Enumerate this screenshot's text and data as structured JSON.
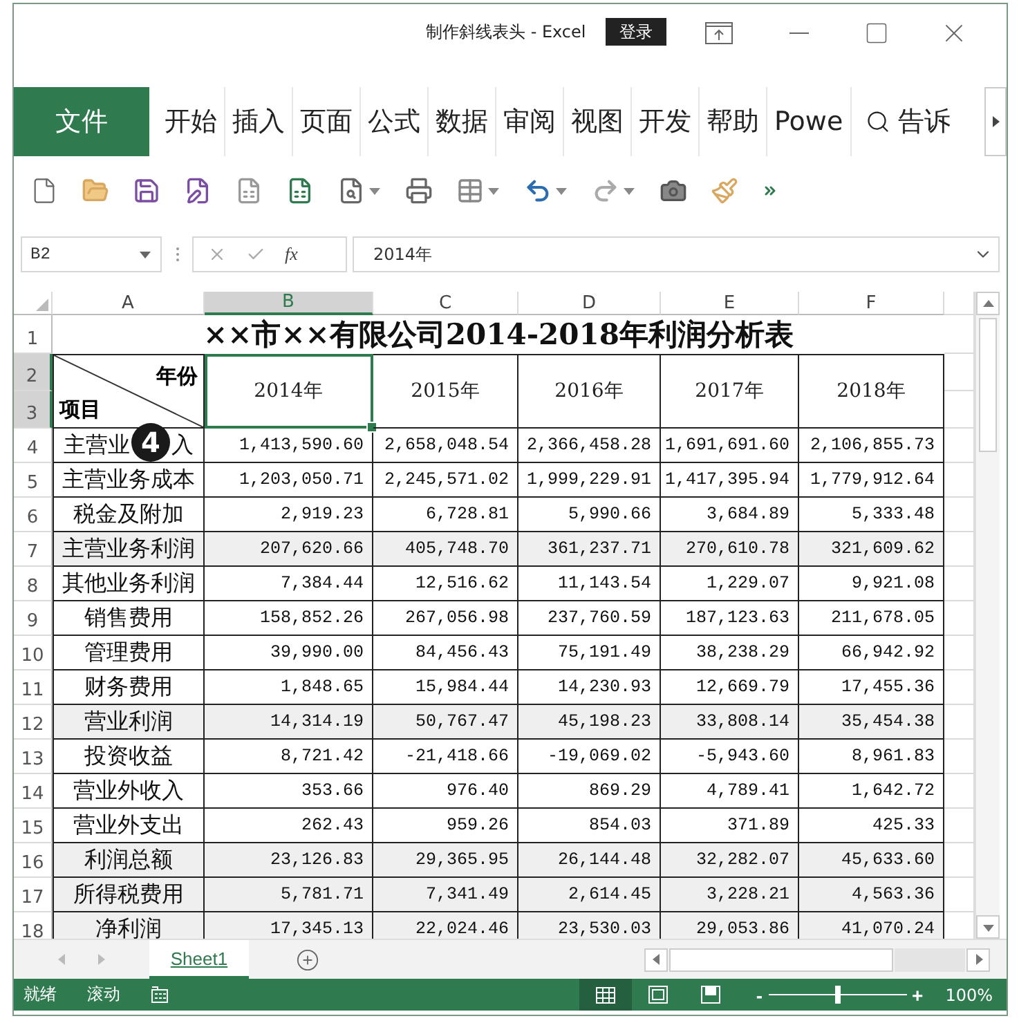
{
  "window": {
    "title": "制作斜线表头 - Excel",
    "login": "登录"
  },
  "ribbon": {
    "tabs": [
      {
        "label": "文件",
        "kind": "file",
        "selected": false
      },
      {
        "label": "开始",
        "kind": "tab",
        "selected": false
      },
      {
        "label": "插入",
        "kind": "tab",
        "selected": false
      },
      {
        "label": "页面",
        "kind": "tab",
        "selected": false
      },
      {
        "label": "公式",
        "kind": "tab",
        "selected": false
      },
      {
        "label": "数据",
        "kind": "tab",
        "selected": false
      },
      {
        "label": "审阅",
        "kind": "tab",
        "selected": false
      },
      {
        "label": "视图",
        "kind": "tab",
        "selected": false
      },
      {
        "label": "开发",
        "kind": "tab",
        "selected": false
      },
      {
        "label": "帮助",
        "kind": "tab",
        "selected": false
      },
      {
        "label": "Powe",
        "kind": "tab",
        "selected": false
      }
    ],
    "tell_me": "告诉"
  },
  "formula_bar": {
    "name_box": "B2",
    "function_label": "fx",
    "value": "2014年"
  },
  "column_headers": [
    {
      "label": "A",
      "selected": false
    },
    {
      "label": "B",
      "selected": true
    },
    {
      "label": "C",
      "selected": false
    },
    {
      "label": "D",
      "selected": false
    },
    {
      "label": "E",
      "selected": false
    },
    {
      "label": "F",
      "selected": false
    }
  ],
  "row_headers": [
    {
      "label": "1",
      "selected": false
    },
    {
      "label": "2",
      "selected": true
    },
    {
      "label": "3",
      "selected": true
    },
    {
      "label": "4",
      "selected": false
    },
    {
      "label": "5",
      "selected": false
    },
    {
      "label": "6",
      "selected": false
    },
    {
      "label": "7",
      "selected": false
    },
    {
      "label": "8",
      "selected": false
    },
    {
      "label": "9",
      "selected": false
    },
    {
      "label": "10",
      "selected": false
    },
    {
      "label": "11",
      "selected": false
    },
    {
      "label": "12",
      "selected": false
    },
    {
      "label": "13",
      "selected": false
    },
    {
      "label": "14",
      "selected": false
    },
    {
      "label": "15",
      "selected": false
    },
    {
      "label": "16",
      "selected": false
    },
    {
      "label": "17",
      "selected": false
    },
    {
      "label": "18",
      "selected": false
    }
  ],
  "sheet": {
    "title": "××市××有限公司2014-2018年利润分析表",
    "header": {
      "year_label": "年份",
      "item_label": "项目",
      "years": [
        "2014年",
        "2015年",
        "2016年",
        "2017年",
        "2018年"
      ],
      "selected": true
    },
    "rows": [
      {
        "label": "主营业",
        "callout": "4",
        "label_tail": "入",
        "shaded": false,
        "values": [
          "1,413,590.60",
          "2,658,048.54",
          "2,366,458.28",
          "1,691,691.60",
          "2,106,855.73"
        ]
      },
      {
        "label": "主营业务成本",
        "shaded": false,
        "values": [
          "1,203,050.71",
          "2,245,571.02",
          "1,999,229.91",
          "1,417,395.94",
          "1,779,912.64"
        ]
      },
      {
        "label": "税金及附加",
        "shaded": false,
        "values": [
          "2,919.23",
          "6,728.81",
          "5,990.66",
          "3,684.89",
          "5,333.48"
        ]
      },
      {
        "label": "主营业务利润",
        "shaded": true,
        "values": [
          "207,620.66",
          "405,748.70",
          "361,237.71",
          "270,610.78",
          "321,609.62"
        ]
      },
      {
        "label": "其他业务利润",
        "shaded": false,
        "values": [
          "7,384.44",
          "12,516.62",
          "11,143.54",
          "1,229.07",
          "9,921.08"
        ]
      },
      {
        "label": "销售费用",
        "shaded": false,
        "values": [
          "158,852.26",
          "267,056.98",
          "237,760.59",
          "187,123.63",
          "211,678.05"
        ]
      },
      {
        "label": "管理费用",
        "shaded": false,
        "values": [
          "39,990.00",
          "84,456.43",
          "75,191.49",
          "38,238.29",
          "66,942.92"
        ]
      },
      {
        "label": "财务费用",
        "shaded": false,
        "values": [
          "1,848.65",
          "15,984.44",
          "14,230.93",
          "12,669.79",
          "17,455.36"
        ]
      },
      {
        "label": "营业利润",
        "shaded": true,
        "values": [
          "14,314.19",
          "50,767.47",
          "45,198.23",
          "33,808.14",
          "35,454.38"
        ]
      },
      {
        "label": "投资收益",
        "shaded": false,
        "values": [
          "8,721.42",
          "-21,418.66",
          "-19,069.02",
          "-5,943.60",
          "8,961.83"
        ]
      },
      {
        "label": "营业外收入",
        "shaded": false,
        "values": [
          "353.66",
          "976.40",
          "869.29",
          "4,789.41",
          "1,642.72"
        ]
      },
      {
        "label": "营业外支出",
        "shaded": false,
        "values": [
          "262.43",
          "959.26",
          "854.03",
          "371.89",
          "425.33"
        ]
      },
      {
        "label": "利润总额",
        "shaded": true,
        "values": [
          "23,126.83",
          "29,365.95",
          "26,144.48",
          "32,282.07",
          "45,633.60"
        ]
      },
      {
        "label": "所得税费用",
        "shaded": true,
        "values": [
          "5,781.71",
          "7,341.49",
          "2,614.45",
          "3,228.21",
          "4,563.36"
        ]
      },
      {
        "label": "净利润",
        "shaded": true,
        "values": [
          "17,345.13",
          "22,024.46",
          "23,530.03",
          "29,053.86",
          "41,070.24"
        ]
      }
    ]
  },
  "sheet_tabs": [
    {
      "label": "Sheet1",
      "selected": true
    }
  ],
  "status_bar": {
    "ready": "就绪",
    "scroll": "滚动",
    "views": [
      {
        "kind": "normal",
        "selected": true
      },
      {
        "kind": "page_layout",
        "selected": false
      },
      {
        "kind": "page_break",
        "selected": false
      }
    ],
    "zoom_out": "-",
    "zoom_in": "+",
    "zoom_slider": {
      "level": 0.5
    },
    "zoom": "100%"
  }
}
